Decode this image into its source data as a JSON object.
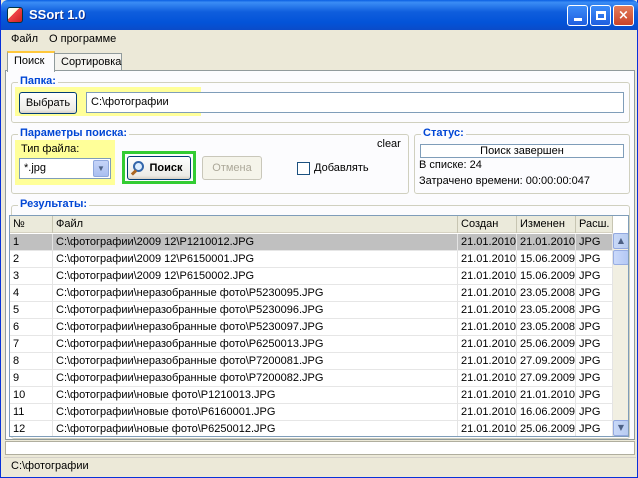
{
  "window": {
    "title": "SSort 1.0",
    "minimize": "minimize",
    "maximize": "maximize",
    "close": "×"
  },
  "menu": {
    "file": "Файл",
    "about": "О программе"
  },
  "tabs": [
    {
      "label": "Поиск",
      "active": true
    },
    {
      "label": "Сортировка",
      "active": false
    }
  ],
  "folder": {
    "title": "Папка:",
    "choose_label": "Выбрать",
    "path": "C:\\фотографии"
  },
  "search_params": {
    "title": "Параметры поиска:",
    "filetype_label": "Тип файла:",
    "filetype_value": "*.jpg",
    "clear_label": "clear",
    "search_label": "Поиск",
    "cancel_label": "Отмена",
    "append_label": "Добавлять",
    "append_checked": false
  },
  "status": {
    "title": "Статус:",
    "state": "Поиск завершен",
    "count": "В списке: 24",
    "elapsed": "Затрачено времени: 00:00:00:047"
  },
  "results": {
    "title": "Результаты:",
    "columns": [
      "№",
      "Файл",
      "Создан",
      "Изменен",
      "Расш."
    ],
    "rows": [
      [
        "1",
        "C:\\фотографии\\2009 12\\P1210012.JPG",
        "21.01.2010",
        "21.01.2010",
        "JPG"
      ],
      [
        "2",
        "C:\\фотографии\\2009 12\\P6150001.JPG",
        "21.01.2010",
        "15.06.2009",
        "JPG"
      ],
      [
        "3",
        "C:\\фотографии\\2009 12\\P6150002.JPG",
        "21.01.2010",
        "15.06.2009",
        "JPG"
      ],
      [
        "4",
        "C:\\фотографии\\неразобранные фото\\P5230095.JPG",
        "21.01.2010",
        "23.05.2008",
        "JPG"
      ],
      [
        "5",
        "C:\\фотографии\\неразобранные фото\\P5230096.JPG",
        "21.01.2010",
        "23.05.2008",
        "JPG"
      ],
      [
        "6",
        "C:\\фотографии\\неразобранные фото\\P5230097.JPG",
        "21.01.2010",
        "23.05.2008",
        "JPG"
      ],
      [
        "7",
        "C:\\фотографии\\неразобранные фото\\P6250013.JPG",
        "21.01.2010",
        "25.06.2009",
        "JPG"
      ],
      [
        "8",
        "C:\\фотографии\\неразобранные фото\\P7200081.JPG",
        "21.01.2010",
        "27.09.2009",
        "JPG"
      ],
      [
        "9",
        "C:\\фотографии\\неразобранные фото\\P7200082.JPG",
        "21.01.2010",
        "27.09.2009",
        "JPG"
      ],
      [
        "10",
        "C:\\фотографии\\новые фото\\P1210013.JPG",
        "21.01.2010",
        "21.01.2010",
        "JPG"
      ],
      [
        "11",
        "C:\\фотографии\\новые фото\\P6160001.JPG",
        "21.01.2010",
        "16.06.2009",
        "JPG"
      ],
      [
        "12",
        "C:\\фотографии\\новые фото\\P6250012.JPG",
        "21.01.2010",
        "25.06.2009",
        "JPG"
      ]
    ],
    "selected_row": 0
  },
  "statusbar": {
    "text": "C:\\фотографии"
  },
  "colors": {
    "group_title": "#0046D5",
    "highlight": "#FFFF99",
    "search_border": "#33CC33"
  }
}
